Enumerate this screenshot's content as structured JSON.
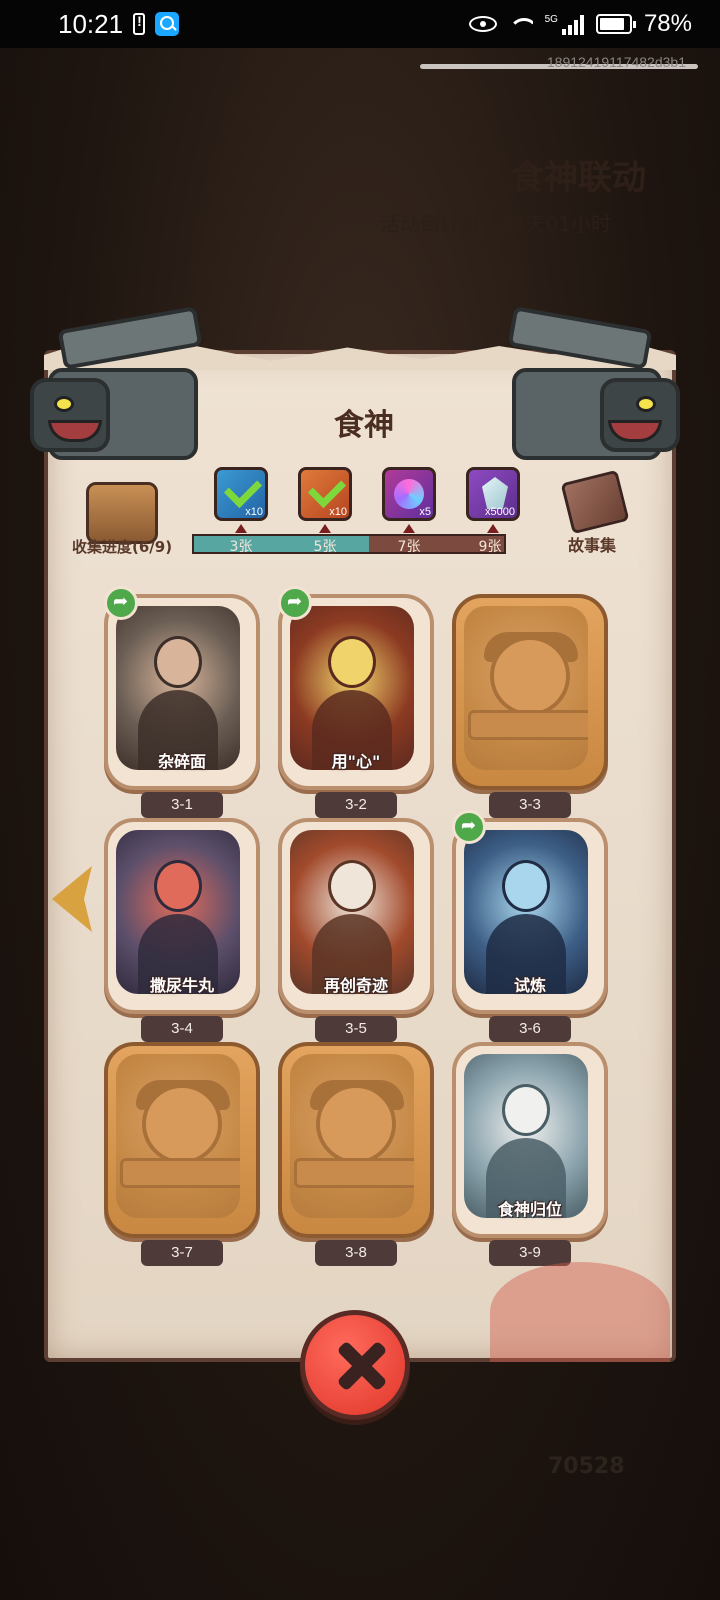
{
  "status_bar": {
    "time": "10:21",
    "network": "5G",
    "battery": "78%"
  },
  "background": {
    "event_title": "食神联动",
    "countdown": "活动倒计时：17天01小时",
    "score": "70528",
    "debug_id": "18912419117482d3b1"
  },
  "panel": {
    "title": "食神"
  },
  "progress": {
    "label": "收集进度(6/9)",
    "collected": 6,
    "total": 9,
    "milestones": [
      {
        "label": "3张",
        "reward_icon": "blue-card-icon",
        "qty": "x10",
        "claimed": true
      },
      {
        "label": "5张",
        "reward_icon": "orange-card-icon",
        "qty": "x10",
        "claimed": true
      },
      {
        "label": "7张",
        "reward_icon": "swirl-orb-icon",
        "qty": "x5",
        "claimed": false
      },
      {
        "label": "9张",
        "reward_icon": "crystal-gem-icon",
        "qty": "x5000",
        "claimed": false
      }
    ]
  },
  "story": {
    "label": "故事集"
  },
  "cards": [
    {
      "num": "3-1",
      "title": "杂碎面",
      "unlocked": true,
      "share": true
    },
    {
      "num": "3-2",
      "title": "用\"心\"",
      "unlocked": true,
      "share": true
    },
    {
      "num": "3-3",
      "title": "",
      "unlocked": false,
      "share": false
    },
    {
      "num": "3-4",
      "title": "撒尿牛丸",
      "unlocked": true,
      "share": false
    },
    {
      "num": "3-5",
      "title": "再创奇迹",
      "unlocked": true,
      "share": false
    },
    {
      "num": "3-6",
      "title": "试炼",
      "unlocked": true,
      "share": true
    },
    {
      "num": "3-7",
      "title": "",
      "unlocked": false,
      "share": false
    },
    {
      "num": "3-8",
      "title": "",
      "unlocked": false,
      "share": false
    },
    {
      "num": "3-9",
      "title": "食神归位",
      "unlocked": true,
      "share": false
    }
  ],
  "colors": {
    "progress_fill": "#58a6a2",
    "progress_track": "#7c4a3e",
    "close_button": "#e0352a",
    "share_badge": "#4fa84a"
  }
}
